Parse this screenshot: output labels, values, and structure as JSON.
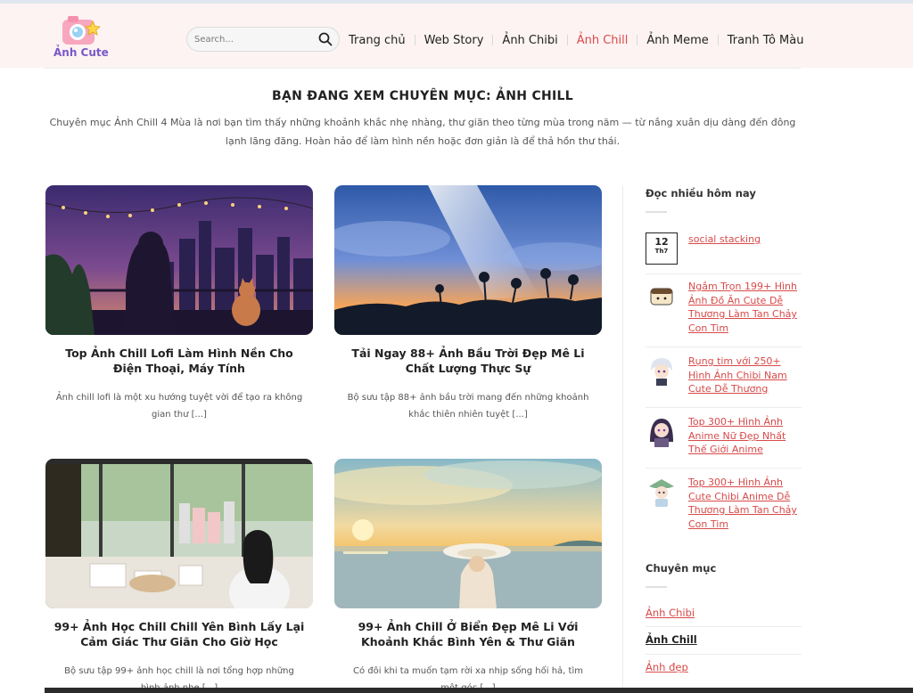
{
  "site": {
    "logo_text": "Ảnh Cute",
    "brand_color": "#7b57c9",
    "accent_color": "#d84a4a"
  },
  "search": {
    "placeholder": "Search...",
    "icon": "search-icon"
  },
  "nav": {
    "items": [
      {
        "label": "Trang chủ"
      },
      {
        "label": "Web Story"
      },
      {
        "label": "Ảnh Chibi"
      },
      {
        "label": "Ảnh Chill",
        "active": true
      },
      {
        "label": "Ảnh Meme"
      },
      {
        "label": "Tranh Tô Màu"
      }
    ]
  },
  "page": {
    "title": "BẠN ĐANG XEM CHUYÊN MỤC: ẢNH CHILL",
    "description": "Chuyên mục Ảnh Chill 4 Mùa là nơi bạn tìm thấy những khoảnh khắc nhẹ nhàng, thư giãn theo từng mùa trong năm — từ nắng xuân dịu dàng đến đông lạnh lãng đãng. Hoàn hảo để làm hình nền hoặc đơn giản là để thả hồn thư thái."
  },
  "posts": [
    {
      "title": "Top Ảnh Chill Lofi Làm Hình Nền Cho Điện Thoại, Máy Tính",
      "excerpt": "Ảnh chill lofi là một xu hướng tuyệt vời để tạo ra không gian thư [...]"
    },
    {
      "title": "Tải Ngay 88+ Ảnh Bầu Trời Đẹp Mê Li Chất Lượng Thực Sự",
      "excerpt": "Bộ sưu tập 88+ ảnh bầu trời mang đến những khoảnh khắc thiên nhiên tuyệt [...]"
    },
    {
      "title": "99+ Ảnh Học Chill Chill Yên Bình Lấy Lại Cảm Giác Thư Giãn Cho Giờ Học",
      "excerpt": "Bộ sưu tập 99+ ảnh học chill là nơi tổng hợp những hình ảnh nhẹ [...]"
    },
    {
      "title": "99+ Ảnh Chill Ở Biển Đẹp Mê Li Với Khoảnh Khắc Bình Yên & Thư Giãn",
      "excerpt": "Có đôi khi ta muốn tạm rời xa nhịp sống hối hả, tìm một góc [...]"
    }
  ],
  "sidebar": {
    "popular_heading": "Đọc nhiều hôm nay",
    "popular": [
      {
        "day": "12",
        "month": "Th7",
        "title": "social stacking"
      },
      {
        "title": "Ngắm Trọn 199+ Hình Ảnh Đồ Ăn Cute Dễ Thương Làm Tan Chảy Con Tim"
      },
      {
        "title": "Rụng tim với 250+ Hình Ảnh Chibi Nam Cute Dễ Thương"
      },
      {
        "title": "Top 300+ Hình Ảnh Anime Nữ Đẹp Nhất Thế Giới Anime"
      },
      {
        "title": "Top 300+ Hình Ảnh Cute Chibi Anime Dễ Thương Làm Tan Chảy Con Tim"
      }
    ],
    "categories_heading": "Chuyên mục",
    "categories": [
      {
        "label": "Ảnh Chibi"
      },
      {
        "label": "Ảnh Chill",
        "current": true
      },
      {
        "label": "Ảnh đẹp"
      }
    ]
  }
}
